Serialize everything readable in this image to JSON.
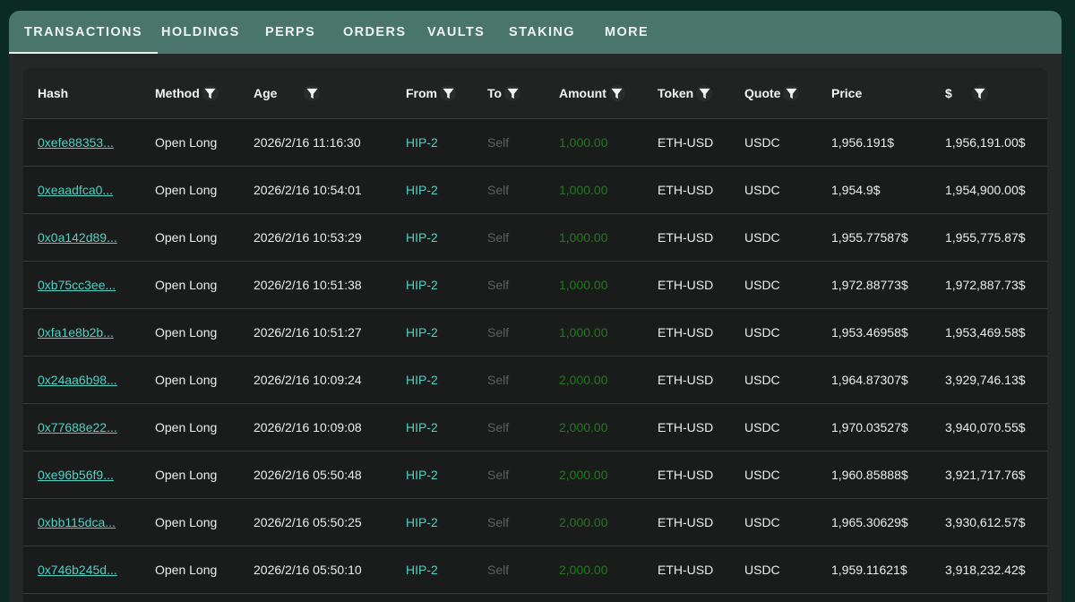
{
  "tabs": [
    {
      "label": "TRANSACTIONS",
      "active": true
    },
    {
      "label": "HOLDINGS",
      "active": false
    },
    {
      "label": "PERPS",
      "active": false
    },
    {
      "label": "ORDERS",
      "active": false
    },
    {
      "label": "VAULTS",
      "active": false
    },
    {
      "label": "STAKING",
      "active": false
    },
    {
      "label": "MORE",
      "active": false
    }
  ],
  "table": {
    "columns": [
      {
        "label": "Hash",
        "filter": false
      },
      {
        "label": "Method",
        "filter": true
      },
      {
        "label": "Age",
        "filter": true
      },
      {
        "label": "From",
        "filter": true
      },
      {
        "label": "To",
        "filter": true
      },
      {
        "label": "Amount",
        "filter": true
      },
      {
        "label": "Token",
        "filter": true
      },
      {
        "label": "Quote",
        "filter": true
      },
      {
        "label": "Price",
        "filter": false
      },
      {
        "label": "$",
        "filter": true
      }
    ],
    "rows": [
      {
        "hash": "0xefe88353...",
        "method": "Open Long",
        "age": "2026/2/16 11:16:30",
        "from": "HIP-2",
        "to": "Self",
        "amount": "1,000.00",
        "token": "ETH-USD",
        "quote": "USDC",
        "price": "1,956.191$",
        "usd": "1,956,191.00$"
      },
      {
        "hash": "0xeaadfca0...",
        "method": "Open Long",
        "age": "2026/2/16 10:54:01",
        "from": "HIP-2",
        "to": "Self",
        "amount": "1,000.00",
        "token": "ETH-USD",
        "quote": "USDC",
        "price": "1,954.9$",
        "usd": "1,954,900.00$"
      },
      {
        "hash": "0x0a142d89...",
        "method": "Open Long",
        "age": "2026/2/16 10:53:29",
        "from": "HIP-2",
        "to": "Self",
        "amount": "1,000.00",
        "token": "ETH-USD",
        "quote": "USDC",
        "price": "1,955.77587$",
        "usd": "1,955,775.87$"
      },
      {
        "hash": "0xb75cc3ee...",
        "method": "Open Long",
        "age": "2026/2/16 10:51:38",
        "from": "HIP-2",
        "to": "Self",
        "amount": "1,000.00",
        "token": "ETH-USD",
        "quote": "USDC",
        "price": "1,972.88773$",
        "usd": "1,972,887.73$"
      },
      {
        "hash": "0xfa1e8b2b...",
        "method": "Open Long",
        "age": "2026/2/16 10:51:27",
        "from": "HIP-2",
        "to": "Self",
        "amount": "1,000.00",
        "token": "ETH-USD",
        "quote": "USDC",
        "price": "1,953.46958$",
        "usd": "1,953,469.58$"
      },
      {
        "hash": "0x24aa6b98...",
        "method": "Open Long",
        "age": "2026/2/16 10:09:24",
        "from": "HIP-2",
        "to": "Self",
        "amount": "2,000.00",
        "token": "ETH-USD",
        "quote": "USDC",
        "price": "1,964.87307$",
        "usd": "3,929,746.13$"
      },
      {
        "hash": "0x77688e22...",
        "method": "Open Long",
        "age": "2026/2/16 10:09:08",
        "from": "HIP-2",
        "to": "Self",
        "amount": "2,000.00",
        "token": "ETH-USD",
        "quote": "USDC",
        "price": "1,970.03527$",
        "usd": "3,940,070.55$"
      },
      {
        "hash": "0xe96b56f9...",
        "method": "Open Long",
        "age": "2026/2/16 05:50:48",
        "from": "HIP-2",
        "to": "Self",
        "amount": "2,000.00",
        "token": "ETH-USD",
        "quote": "USDC",
        "price": "1,960.85888$",
        "usd": "3,921,717.76$"
      },
      {
        "hash": "0xbb115dca...",
        "method": "Open Long",
        "age": "2026/2/16 05:50:25",
        "from": "HIP-2",
        "to": "Self",
        "amount": "2,000.00",
        "token": "ETH-USD",
        "quote": "USDC",
        "price": "1,965.30629$",
        "usd": "3,930,612.57$"
      },
      {
        "hash": "0x746b245d...",
        "method": "Open Long",
        "age": "2026/2/16 05:50:10",
        "from": "HIP-2",
        "to": "Self",
        "amount": "2,000.00",
        "token": "ETH-USD",
        "quote": "USDC",
        "price": "1,959.11621$",
        "usd": "3,918,232.42$"
      }
    ]
  }
}
